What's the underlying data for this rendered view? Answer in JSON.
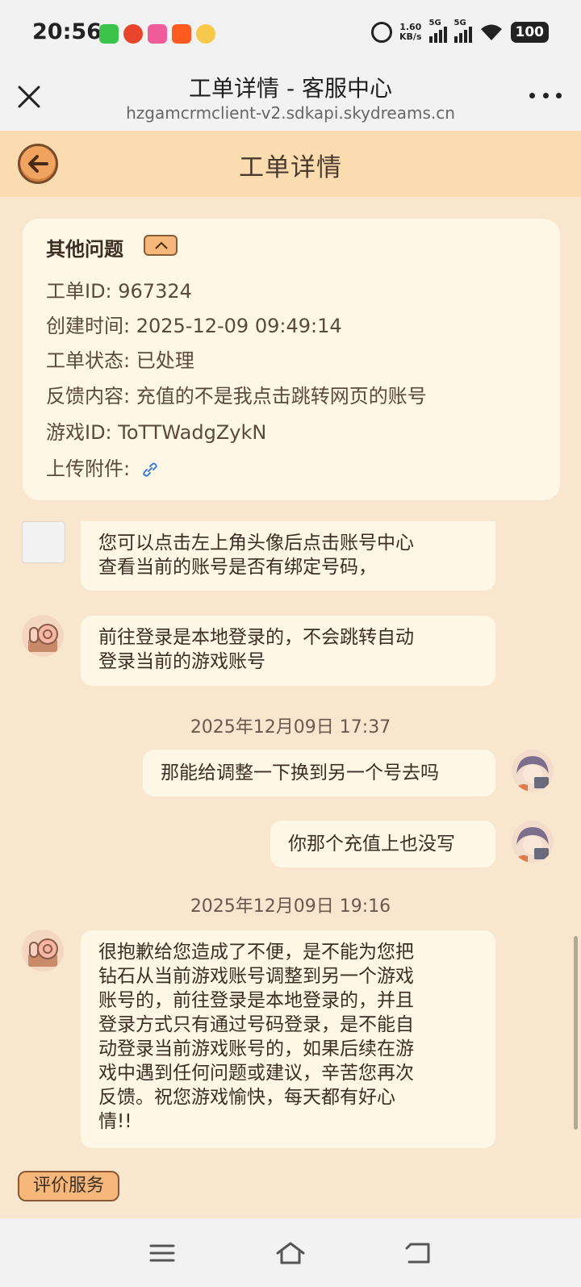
{
  "status_bar": {
    "time": "20:56",
    "net_speed_value": "1.60",
    "net_speed_unit": "KB/s",
    "signal1_label": "5G",
    "signal2_label": "5G",
    "battery": "100"
  },
  "browser": {
    "title": "工单详情 - 客服中心",
    "url": "hzgamcrmclient-v2.sdkapi.skydreams.cn"
  },
  "header": {
    "title": "工单详情"
  },
  "ticket": {
    "category": "其他问题",
    "id_label": "工单ID: 967324",
    "created_label": "创建时间: 2025-12-09 09:49:14",
    "status_label": "工单状态: 已处理",
    "feedback_label": "反馈内容: 充值的不是我点击跳转网页的账号",
    "game_id_label": "游戏ID: ToTTWadgZykN",
    "attachment_label": "上传附件:"
  },
  "messages": {
    "m1_line1": "您可以点击左上角头像后点击账号中心",
    "m1_line2": "查看当前的账号是否有绑定号码，",
    "m2_line1": "前往登录是本地登录的，不会跳转自动",
    "m2_line2": "登录当前的游戏账号",
    "ts1": "2025年12月09日 17:37",
    "m3": "那能给调整一下换到另一个号去吗",
    "m4": "你那个充值上也没写",
    "ts2": "2025年12月09日 19:16",
    "m5_lines": [
      "很抱歉给您造成了不便，是不能为您把",
      "钻石从当前游戏账号调整到另一个游戏",
      "账号的，前往登录是本地登录的，并且",
      "登录方式只有通过号码登录，是不能自",
      "动登录当前游戏账号的，如果后续在游",
      "戏中遇到任何问题或建议，辛苦您再次",
      "反馈。祝您游戏愉快，每天都有好心",
      "情!!"
    ]
  },
  "rate_button": "评价服务",
  "icons": {
    "close": "close-icon",
    "more": "more-icon",
    "back": "back-arrow-icon",
    "collapse": "chevron-up-icon",
    "link": "link-icon",
    "agent_avatar": "snail-avatar",
    "user_avatar": "user-avatar",
    "nav_menu": "menu-icon",
    "nav_home": "home-icon",
    "nav_back": "back-icon"
  },
  "colors": {
    "background": "#f8e6cf",
    "header": "#fbdcb0",
    "bubble": "#fff7e6",
    "accent": "#f5b87a"
  }
}
